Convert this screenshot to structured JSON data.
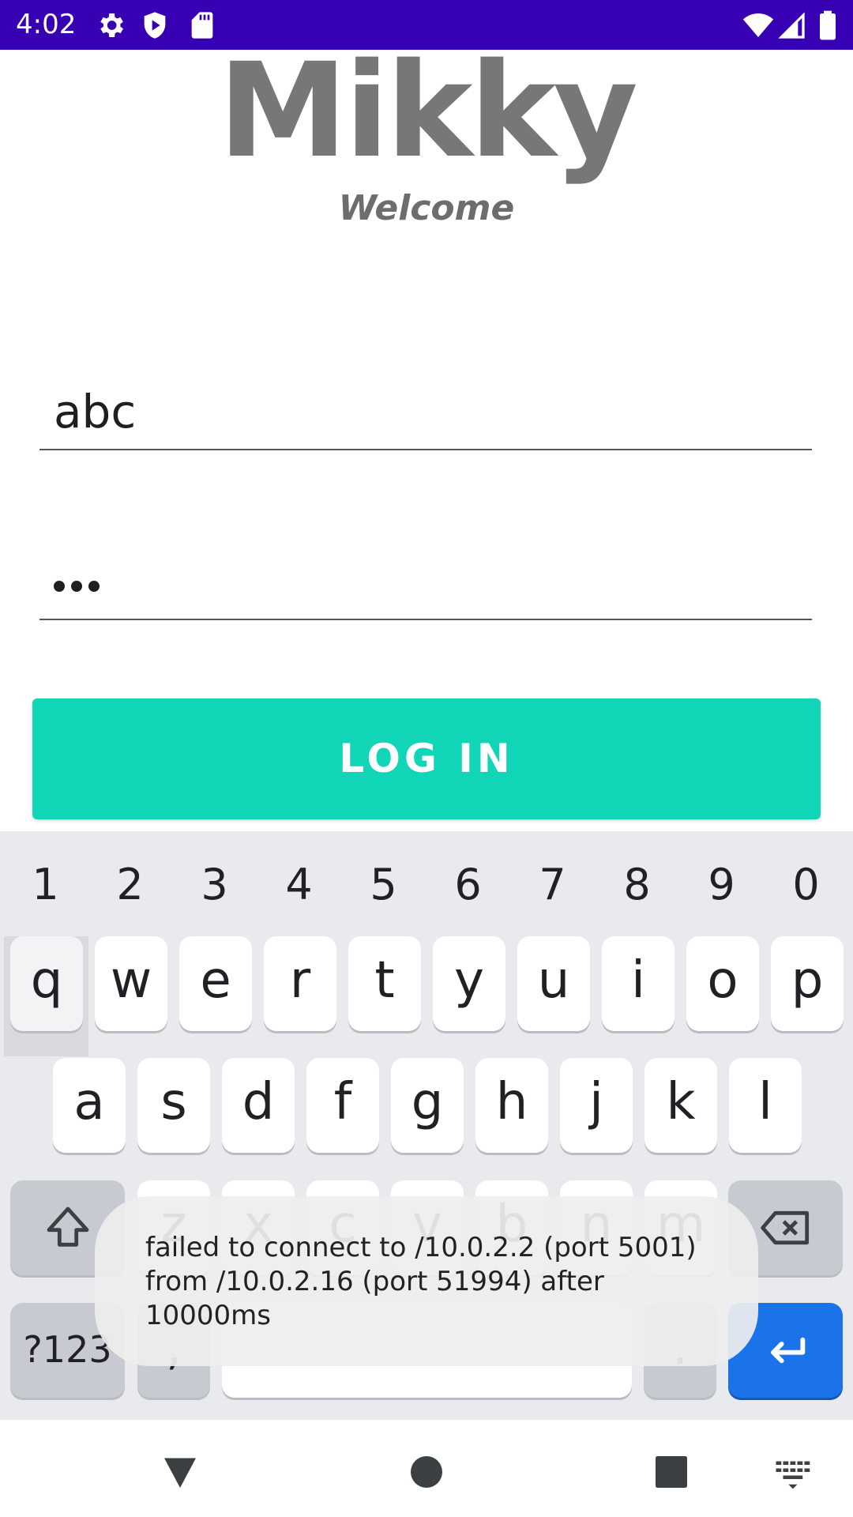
{
  "status_bar": {
    "time": "4:02",
    "bg_color": "#3700b3",
    "left_icons": [
      "settings-icon",
      "shield-play-icon",
      "sd-card-icon"
    ],
    "right_icons": [
      "wifi-icon",
      "signal-icon",
      "battery-icon"
    ]
  },
  "app": {
    "title": "Mikky",
    "subtitle": "Welcome",
    "username_value": "abc",
    "password_mask": "•••",
    "login_label": "LOG IN",
    "accent_color": "#10d5b7"
  },
  "keyboard": {
    "number_row": [
      "1",
      "2",
      "3",
      "4",
      "5",
      "6",
      "7",
      "8",
      "9",
      "0"
    ],
    "row1": [
      "q",
      "w",
      "e",
      "r",
      "t",
      "y",
      "u",
      "i",
      "o",
      "p"
    ],
    "row2": [
      "a",
      "s",
      "d",
      "f",
      "g",
      "h",
      "j",
      "k",
      "l"
    ],
    "row3": [
      "z",
      "x",
      "c",
      "v",
      "b",
      "n",
      "m"
    ],
    "symbols_label": "?123",
    "comma": ",",
    "period": ".",
    "enter_color": "#1a73e8"
  },
  "toast": {
    "message": "failed to connect to /10.0.2.2 (port 5001) from /10.0.2.16 (port 51994) after 10000ms"
  },
  "nav_bar": {
    "buttons": [
      "back-icon",
      "home-icon",
      "recents-icon",
      "keyboard-switch-icon"
    ]
  }
}
